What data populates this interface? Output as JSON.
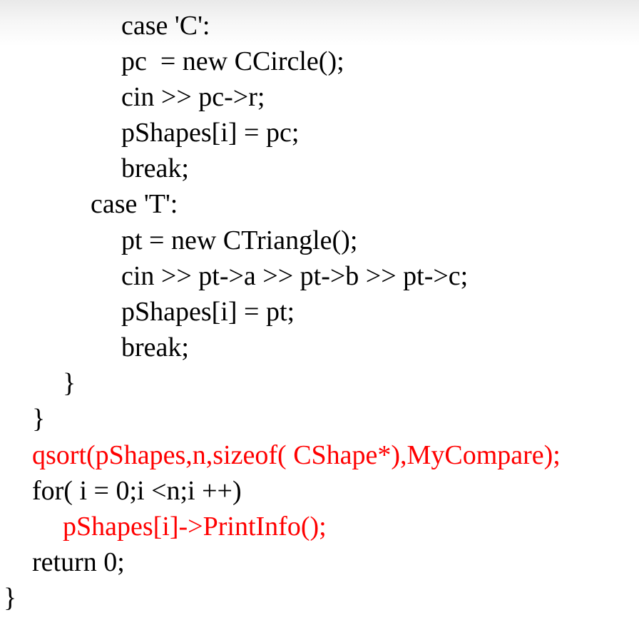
{
  "code": {
    "lines": [
      {
        "text": "case 'C':",
        "highlight": false
      },
      {
        "text": "pc  = new CCircle();",
        "highlight": false
      },
      {
        "text": "cin >> pc->r;",
        "highlight": false
      },
      {
        "text": "pShapes[i] = pc;",
        "highlight": false
      },
      {
        "text": "break;",
        "highlight": false
      },
      {
        "text": "case 'T':",
        "highlight": false
      },
      {
        "text": "pt = new CTriangle();",
        "highlight": false
      },
      {
        "text": "cin >> pt->a >> pt->b >> pt->c;",
        "highlight": false
      },
      {
        "text": "pShapes[i] = pt;",
        "highlight": false
      },
      {
        "text": "break;",
        "highlight": false
      },
      {
        "text": "}",
        "highlight": false
      },
      {
        "text": "}",
        "highlight": false
      },
      {
        "text": "qsort(pShapes,n,sizeof( CShape*),MyCompare);",
        "highlight": true
      },
      {
        "text": "for( i = 0;i <n;i ++)",
        "highlight": false
      },
      {
        "text": "pShapes[i]->PrintInfo();",
        "highlight": true
      },
      {
        "text": "return 0;",
        "highlight": false
      },
      {
        "text": "}",
        "highlight": false
      }
    ]
  },
  "colors": {
    "text": "#000000",
    "highlight": "#ff0000"
  }
}
